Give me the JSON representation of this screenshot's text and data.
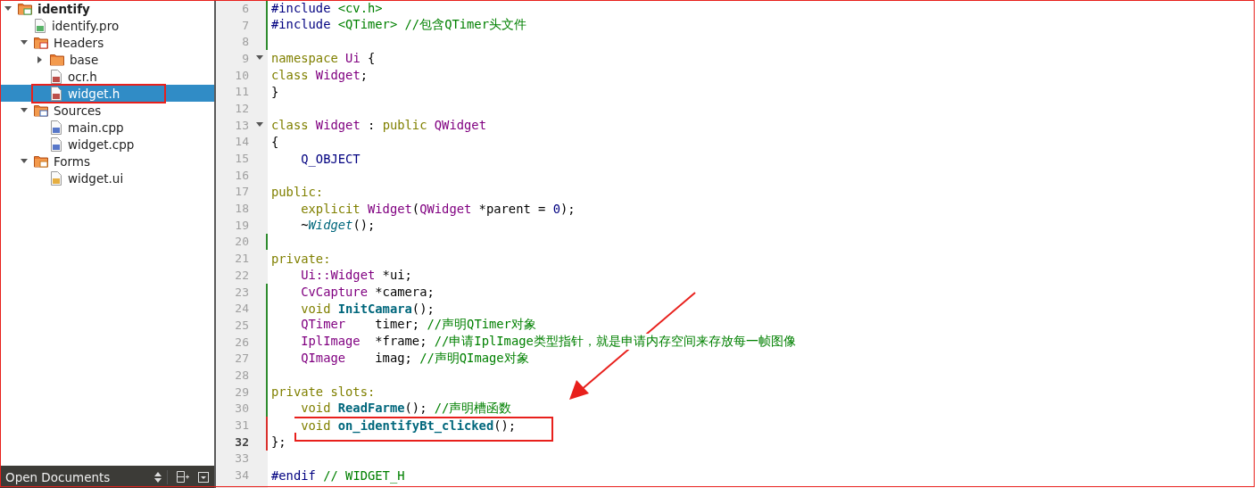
{
  "project_tree": [
    {
      "label": "identify",
      "kind": "project",
      "expanded": true,
      "selected": false,
      "children": [
        {
          "label": "identify.pro",
          "kind": "pro-file",
          "selected": false
        },
        {
          "label": "Headers",
          "kind": "header-folder",
          "expanded": true,
          "selected": false,
          "children": [
            {
              "label": "base",
              "kind": "folder",
              "expanded": false,
              "selected": false
            },
            {
              "label": "ocr.h",
              "kind": "header-file",
              "selected": false
            },
            {
              "label": "widget.h",
              "kind": "header-file",
              "selected": true
            }
          ]
        },
        {
          "label": "Sources",
          "kind": "source-folder",
          "expanded": true,
          "selected": false,
          "children": [
            {
              "label": "main.cpp",
              "kind": "source-file",
              "selected": false
            },
            {
              "label": "widget.cpp",
              "kind": "source-file",
              "selected": false
            }
          ]
        },
        {
          "label": "Forms",
          "kind": "form-folder",
          "expanded": true,
          "selected": false,
          "children": [
            {
              "label": "widget.ui",
              "kind": "form-file",
              "selected": false
            }
          ]
        }
      ]
    }
  ],
  "bottom_panel": {
    "label": "Open Documents"
  },
  "editor": {
    "lines": [
      {
        "number": "6",
        "color": "#2e8b2e",
        "fold": false,
        "current": false,
        "tokens": [
          {
            "t": "#include",
            "kind": "preprocessor"
          },
          {
            "t": " <cv.h>",
            "kind": "include"
          }
        ]
      },
      {
        "number": "7",
        "color": "#2e8b2e",
        "fold": false,
        "current": false,
        "tokens": [
          {
            "t": "#include",
            "kind": "preprocessor"
          },
          {
            "t": " <QTimer>",
            "kind": "include"
          },
          {
            "t": " //包含QTimer头文件",
            "kind": "comment"
          }
        ]
      },
      {
        "number": "8",
        "color": "#2e8b2e",
        "fold": false,
        "current": false
      },
      {
        "number": "9",
        "fold": true,
        "current": false,
        "tokens": [
          {
            "t": "namespace",
            "kind": "keyword"
          },
          {
            "t": " Ui",
            "kind": "type"
          },
          {
            "t": " {",
            "kind": "plain"
          }
        ]
      },
      {
        "number": "10",
        "fold": false,
        "current": false,
        "tokens": [
          {
            "t": "class",
            "kind": "keyword"
          },
          {
            "t": " Widget",
            "kind": "type"
          },
          {
            "t": ";",
            "kind": "plain"
          }
        ]
      },
      {
        "number": "11",
        "fold": false,
        "current": false,
        "tokens": [
          {
            "t": "}",
            "kind": "plain"
          }
        ]
      },
      {
        "number": "12",
        "fold": false,
        "current": false
      },
      {
        "number": "13",
        "fold": true,
        "current": false,
        "tokens": [
          {
            "t": "class",
            "kind": "keyword"
          },
          {
            "t": " Widget",
            "kind": "type"
          },
          {
            "t": " :",
            "kind": "plain"
          },
          {
            "t": " public",
            "kind": "keyword"
          },
          {
            "t": " QWidget",
            "kind": "type"
          }
        ]
      },
      {
        "number": "14",
        "fold": false,
        "current": false,
        "tokens": [
          {
            "t": "{",
            "kind": "plain"
          }
        ]
      },
      {
        "number": "15",
        "fold": false,
        "current": false,
        "tokens": [
          {
            "t": "    Q_OBJECT",
            "kind": "preprocessor"
          }
        ]
      },
      {
        "number": "16",
        "fold": false,
        "current": false
      },
      {
        "number": "17",
        "fold": false,
        "current": false,
        "tokens": [
          {
            "t": "public:",
            "kind": "keyword"
          }
        ]
      },
      {
        "number": "18",
        "fold": false,
        "current": false,
        "tokens": [
          {
            "t": "    explicit",
            "kind": "keyword"
          },
          {
            "t": " Widget",
            "kind": "type"
          },
          {
            "t": "(",
            "kind": "plain"
          },
          {
            "t": "QWidget",
            "kind": "type"
          },
          {
            "t": " *parent =",
            "kind": "plain"
          },
          {
            "t": " 0",
            "kind": "number"
          },
          {
            "t": ");",
            "kind": "plain"
          }
        ]
      },
      {
        "number": "19",
        "fold": false,
        "current": false,
        "tokens": [
          {
            "t": "    ~",
            "kind": "plain"
          },
          {
            "t": "Widget",
            "kind": "destructor"
          },
          {
            "t": "();",
            "kind": "plain"
          }
        ]
      },
      {
        "number": "20",
        "color": "#2e8b2e",
        "fold": false,
        "current": false
      },
      {
        "number": "21",
        "fold": false,
        "current": false,
        "tokens": [
          {
            "t": "private:",
            "kind": "keyword"
          }
        ]
      },
      {
        "number": "22",
        "fold": false,
        "current": false,
        "tokens": [
          {
            "t": "    Ui::Widget",
            "kind": "type"
          },
          {
            "t": " *ui;",
            "kind": "plain"
          }
        ]
      },
      {
        "number": "23",
        "color": "#2e8b2e",
        "fold": false,
        "current": false,
        "tokens": [
          {
            "t": "    CvCapture",
            "kind": "type"
          },
          {
            "t": " *camera;",
            "kind": "plain"
          }
        ]
      },
      {
        "number": "24",
        "color": "#2e8b2e",
        "fold": false,
        "current": false,
        "tokens": [
          {
            "t": "    void",
            "kind": "keyword"
          },
          {
            "t": " InitCamara",
            "kind": "function"
          },
          {
            "t": "();",
            "kind": "plain"
          }
        ]
      },
      {
        "number": "25",
        "color": "#2e8b2e",
        "fold": false,
        "current": false,
        "tokens": [
          {
            "t": "    QTimer",
            "kind": "type"
          },
          {
            "t": "    timer;",
            "kind": "plain"
          },
          {
            "t": " //声明QTimer对象",
            "kind": "comment"
          }
        ]
      },
      {
        "number": "26",
        "color": "#2e8b2e",
        "fold": false,
        "current": false,
        "tokens": [
          {
            "t": "    IplImage",
            "kind": "type"
          },
          {
            "t": "  *frame;",
            "kind": "plain"
          },
          {
            "t": " //申请IplImage类型指针，就是申请内存空间来存放每一帧图像",
            "kind": "comment"
          }
        ]
      },
      {
        "number": "27",
        "color": "#2e8b2e",
        "fold": false,
        "current": false,
        "tokens": [
          {
            "t": "    QImage",
            "kind": "type"
          },
          {
            "t": "    imag;",
            "kind": "plain"
          },
          {
            "t": " //声明QImage对象",
            "kind": "comment"
          }
        ]
      },
      {
        "number": "28",
        "color": "#2e8b2e",
        "fold": false,
        "current": false
      },
      {
        "number": "29",
        "color": "#2e8b2e",
        "fold": false,
        "current": false,
        "tokens": [
          {
            "t": "private slots:",
            "kind": "keyword"
          }
        ]
      },
      {
        "number": "30",
        "color": "#2e8b2e",
        "fold": false,
        "current": false,
        "tokens": [
          {
            "t": "    void",
            "kind": "keyword"
          },
          {
            "t": " ReadFarme",
            "kind": "function"
          },
          {
            "t": "();",
            "kind": "plain"
          },
          {
            "t": " //声明槽函数",
            "kind": "comment"
          }
        ]
      },
      {
        "number": "31",
        "color": "#d9302c",
        "fold": false,
        "current": false,
        "tokens": [
          {
            "t": "    void",
            "kind": "keyword"
          },
          {
            "t": " on_identifyBt_clicked",
            "kind": "function"
          },
          {
            "t": "();",
            "kind": "plain"
          }
        ]
      },
      {
        "number": "32",
        "color": "#d9302c",
        "fold": false,
        "current": true,
        "tokens": [
          {
            "t": "};",
            "kind": "plain"
          }
        ]
      },
      {
        "number": "33",
        "fold": false,
        "current": false
      },
      {
        "number": "34",
        "fold": false,
        "current": false,
        "tokens": [
          {
            "t": "#endif",
            "kind": "preprocessor"
          },
          {
            "t": " // WIDGET_H",
            "kind": "comment"
          }
        ]
      }
    ]
  }
}
